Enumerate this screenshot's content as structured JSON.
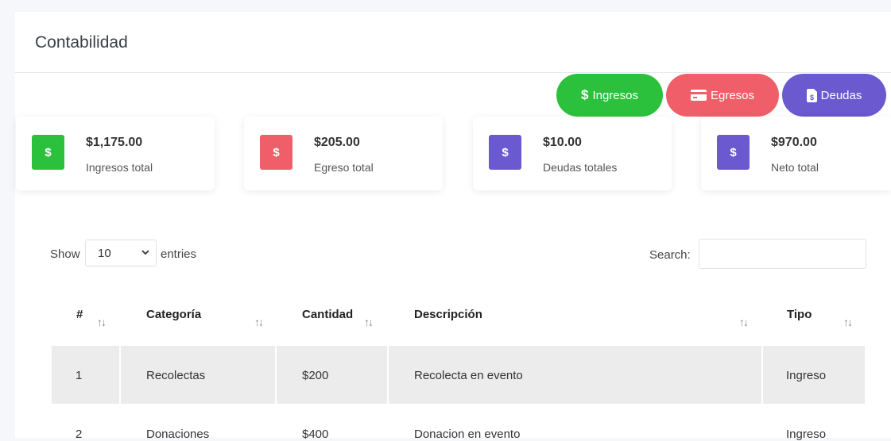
{
  "header": {
    "title": "Contabilidad"
  },
  "actions": [
    {
      "label": "Ingresos",
      "icon": "dollar-icon",
      "color": "#2cc13d"
    },
    {
      "label": "Egresos",
      "icon": "credit-card-icon",
      "color": "#f05f69"
    },
    {
      "label": "Deudas",
      "icon": "invoice-icon",
      "color": "#6a59cf"
    }
  ],
  "summary": [
    {
      "amount": "$1,175.00",
      "label": "Ingresos total",
      "badge": "$",
      "color": "#2cc13d"
    },
    {
      "amount": "$205.00",
      "label": "Egreso total",
      "badge": "$",
      "color": "#f05f69"
    },
    {
      "amount": "$10.00",
      "label": "Deudas totales",
      "badge": "$",
      "color": "#6a59cf"
    },
    {
      "amount": "$970.00",
      "label": "Neto total",
      "badge": "$",
      "color": "#6a59cf"
    }
  ],
  "table_controls": {
    "show_label": "Show",
    "page_size": "10",
    "entries_label": "entries",
    "search_label": "Search:",
    "search_value": ""
  },
  "table": {
    "columns": [
      "#",
      "Categoría",
      "Cantidad",
      "Descripción",
      "Tipo"
    ],
    "sort_icon": "↑↓",
    "rows": [
      [
        "1",
        "Recolectas",
        "$200",
        "Recolecta en evento",
        "Ingreso"
      ],
      [
        "2",
        "Donaciones",
        "$400",
        "Donacion en evento",
        "Ingreso"
      ]
    ]
  }
}
